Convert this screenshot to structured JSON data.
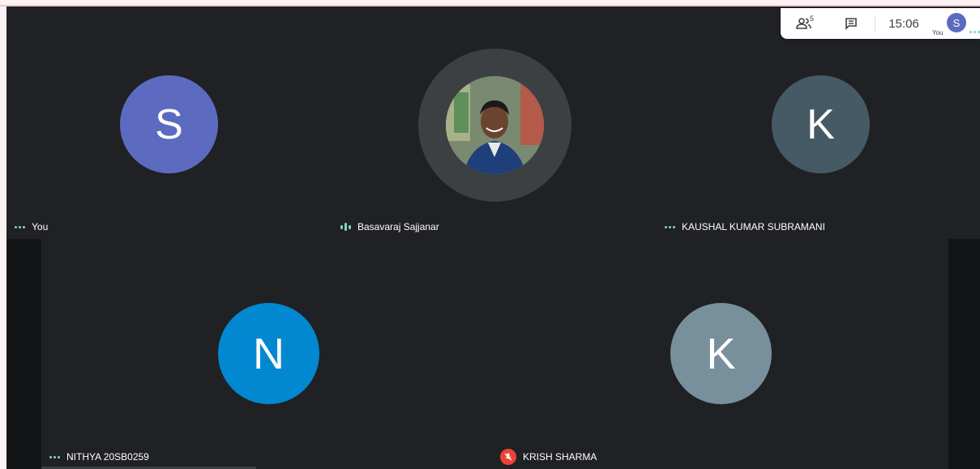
{
  "topbar": {
    "participants_count": "5",
    "time": "15:06",
    "you_label": "You",
    "self_initial": "S"
  },
  "participants": [
    {
      "name": "You",
      "initial": "S",
      "color": "#5c6bc0",
      "status": "more-options"
    },
    {
      "name": "Basavaraj Sajjanar",
      "initial": "",
      "status": "speaking"
    },
    {
      "name": "KAUSHAL KUMAR SUBRAMANI",
      "initial": "K",
      "color": "#455a64",
      "status": "more-options"
    },
    {
      "name": "NITHYA 20SB0259",
      "initial": "N",
      "color": "#0288d1",
      "status": "more-options"
    },
    {
      "name": "KRISH SHARMA",
      "initial": "K",
      "color": "#78909c",
      "status": "muted"
    }
  ]
}
